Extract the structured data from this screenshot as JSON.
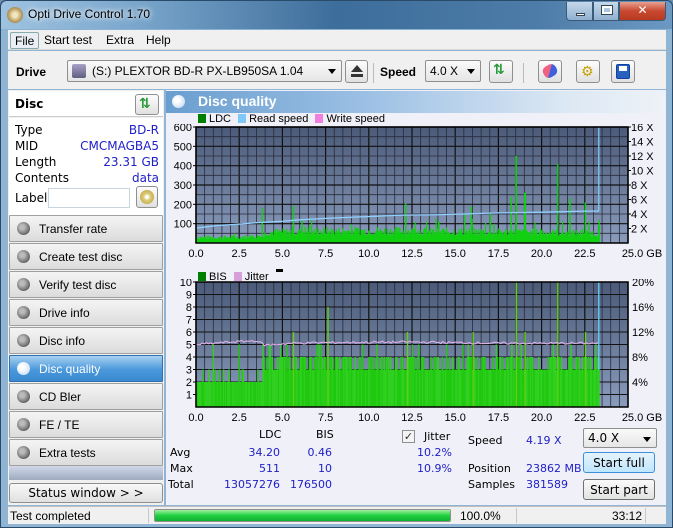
{
  "window": {
    "title": "Opti Drive Control 1.70",
    "controls": {
      "minimize": "minimize",
      "maximize": "maximize",
      "close": "x"
    }
  },
  "menu": [
    "File",
    "Start test",
    "Extra",
    "Help"
  ],
  "toolbar": {
    "drive_label": "Drive",
    "drive_value": "(S:)   PLEXTOR BD-R  PX-LB950SA 1.04",
    "speed_label": "Speed",
    "speed_value": "4.0 X",
    "icons": [
      "eject-icon",
      "refresh-icon",
      "erase-icon",
      "settings-icon",
      "save-icon"
    ]
  },
  "disc": {
    "title": "Disc",
    "fields": [
      {
        "key": "Type",
        "value": "BD-R"
      },
      {
        "key": "MID",
        "value": "CMCMAGBA5"
      },
      {
        "key": "Length",
        "value": "23.31 GB"
      },
      {
        "key": "Contents",
        "value": "data"
      }
    ],
    "label_key": "Label",
    "label_value": ""
  },
  "nav": [
    {
      "label": "Transfer rate",
      "selected": false
    },
    {
      "label": "Create test disc",
      "selected": false
    },
    {
      "label": "Verify test disc",
      "selected": false
    },
    {
      "label": "Drive info",
      "selected": false
    },
    {
      "label": "Disc info",
      "selected": false
    },
    {
      "label": "Disc quality",
      "selected": true
    },
    {
      "label": "CD Bler",
      "selected": false
    },
    {
      "label": "FE / TE",
      "selected": false
    },
    {
      "label": "Extra tests",
      "selected": false
    }
  ],
  "status_window_button": "Status window > >",
  "panel_title": "Disc quality",
  "chart_data": [
    {
      "type": "bar",
      "title": "LDC / Read speed",
      "legend": [
        {
          "name": "LDC",
          "color": "#008000"
        },
        {
          "name": "Read speed",
          "color": "#80c8f8"
        },
        {
          "name": "Write speed",
          "color": "#f080e0"
        }
      ],
      "x_ticks": [
        "0.0",
        "2.5",
        "5.0",
        "7.5",
        "10.0",
        "12.5",
        "15.0",
        "17.5",
        "20.0",
        "22.5",
        "25.0 GB"
      ],
      "xlim": [
        0,
        25
      ],
      "y_left_ticks": [
        "100",
        "200",
        "300",
        "400",
        "500",
        "600"
      ],
      "ylim_left": [
        0,
        600
      ],
      "y_right_ticks": [
        "2 X",
        "4 X",
        "6 X",
        "8 X",
        "10 X",
        "12 X",
        "14 X",
        "16 X"
      ],
      "ylim_right": [
        0,
        16
      ],
      "end_position_gb": 23.31,
      "ldc_baseline": [
        [
          0,
          35
        ],
        [
          2.0,
          35
        ],
        [
          3.9,
          40
        ],
        [
          4.0,
          65
        ],
        [
          6,
          70
        ],
        [
          10,
          75
        ],
        [
          15,
          70
        ],
        [
          20,
          65
        ],
        [
          23.3,
          60
        ]
      ],
      "ldc_spikes": [
        [
          3.8,
          180
        ],
        [
          5.6,
          190
        ],
        [
          6.1,
          120
        ],
        [
          12.1,
          205
        ],
        [
          14.0,
          110
        ],
        [
          15.5,
          150
        ],
        [
          15.9,
          190
        ],
        [
          17.0,
          150
        ],
        [
          18.2,
          240
        ],
        [
          18.5,
          450
        ],
        [
          19.0,
          260
        ],
        [
          20.9,
          410
        ],
        [
          21.6,
          230
        ],
        [
          22.5,
          210
        ],
        [
          23.3,
          120
        ]
      ],
      "read_speed": [
        [
          0,
          2.05
        ],
        [
          0.5,
          2.2
        ],
        [
          1.2,
          2.4
        ],
        [
          2.5,
          2.6
        ],
        [
          3.5,
          2.8
        ],
        [
          5.0,
          3.0
        ],
        [
          6.0,
          3.2
        ],
        [
          7.5,
          3.4
        ],
        [
          9.0,
          3.55
        ],
        [
          10.5,
          3.7
        ],
        [
          12.0,
          3.85
        ],
        [
          14.0,
          3.9
        ],
        [
          15.5,
          4.0
        ],
        [
          17.5,
          4.15
        ],
        [
          20.0,
          4.25
        ],
        [
          21.0,
          4.3
        ],
        [
          22.5,
          4.4
        ],
        [
          23.31,
          4.4
        ]
      ]
    },
    {
      "type": "bar",
      "title": "BIS / Jitter",
      "legend": [
        {
          "name": "BIS",
          "color": "#008000"
        },
        {
          "name": "Jitter",
          "color": "#d8a0d8"
        }
      ],
      "x_ticks": [
        "0.0",
        "2.5",
        "5.0",
        "7.5",
        "10.0",
        "12.5",
        "15.0",
        "17.5",
        "20.0",
        "22.5",
        "25.0 GB"
      ],
      "xlim": [
        0,
        25
      ],
      "y_left_ticks": [
        "1",
        "2",
        "3",
        "4",
        "5",
        "6",
        "7",
        "8",
        "9",
        "10"
      ],
      "ylim_left": [
        0,
        10
      ],
      "y_right_ticks": [
        "4%",
        "8%",
        "12%",
        "16%",
        "20%"
      ],
      "ylim_right": [
        0,
        20
      ],
      "end_position_gb": 23.31,
      "bis_levels": [
        [
          0,
          2
        ],
        [
          3.9,
          3
        ],
        [
          23.31,
          3
        ]
      ],
      "bis_spikes": [
        [
          7.6,
          8
        ],
        [
          5.6,
          6
        ],
        [
          12.2,
          6
        ],
        [
          18.5,
          10
        ],
        [
          20.9,
          10
        ],
        [
          19.0,
          6
        ],
        [
          22.5,
          6
        ],
        [
          16.0,
          6
        ]
      ],
      "jitter": [
        [
          0,
          10.0
        ],
        [
          2.0,
          10.4
        ],
        [
          3.5,
          10.6
        ],
        [
          4.0,
          9.9
        ],
        [
          5.5,
          10.2
        ],
        [
          7.5,
          10.3
        ],
        [
          12.5,
          10.4
        ],
        [
          17.5,
          10.2
        ],
        [
          20.0,
          10.2
        ],
        [
          23.31,
          10.2
        ]
      ]
    }
  ],
  "stats": {
    "col_ldc": "LDC",
    "col_bis": "BIS",
    "jitter_label": "Jitter",
    "jitter_checked": true,
    "rows": [
      {
        "label": "Avg",
        "ldc": "34.20",
        "bis": "0.46",
        "jitter": "10.2%"
      },
      {
        "label": "Max",
        "ldc": "511",
        "bis": "10",
        "jitter": "10.9%"
      },
      {
        "label": "Total",
        "ldc": "13057276",
        "bis": "176500",
        "jitter": ""
      }
    ],
    "speed_label": "Speed",
    "speed_value": "4.19 X",
    "position_label": "Position",
    "position_value": "23862 MB",
    "samples_label": "Samples",
    "samples_value": "381589",
    "speed_select": "4.0 X",
    "start_full": "Start full",
    "start_part": "Start part"
  },
  "statusbar": {
    "text": "Test completed",
    "progress": 1.0,
    "percent": "100.0%",
    "time": "33:12"
  }
}
